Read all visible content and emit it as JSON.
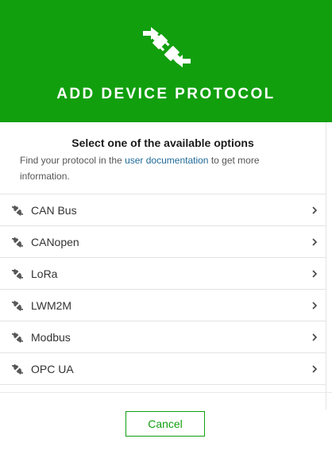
{
  "header": {
    "title": "ADD DEVICE PROTOCOL",
    "icon": "plug-connect-icon",
    "background_color": "#119f0e"
  },
  "intro": {
    "title": "Select one of the available options",
    "text_before_link": "Find your protocol in the ",
    "link_text": "user documentation",
    "text_after_link": " to get more information."
  },
  "protocols": [
    {
      "label": "CAN Bus",
      "icon": "plug-icon"
    },
    {
      "label": "CANopen",
      "icon": "plug-icon"
    },
    {
      "label": "LoRa",
      "icon": "plug-icon"
    },
    {
      "label": "LWM2M",
      "icon": "plug-icon"
    },
    {
      "label": "Modbus",
      "icon": "plug-icon"
    },
    {
      "label": "OPC UA",
      "icon": "plug-icon"
    }
  ],
  "footer": {
    "cancel_label": "Cancel"
  },
  "colors": {
    "accent": "#119f0e",
    "link": "#1f6a9a"
  }
}
